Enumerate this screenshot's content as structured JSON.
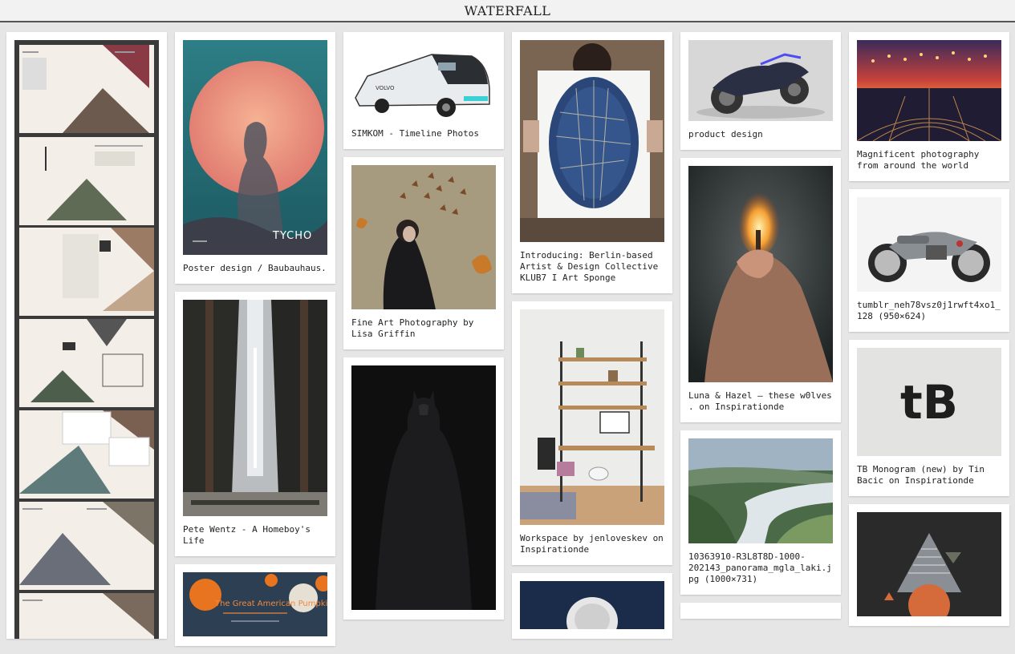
{
  "header": {
    "title": "WATERFALL"
  },
  "columns": [
    [
      {
        "image": "brochure-spread-image",
        "caption": ""
      }
    ],
    [
      {
        "image": "tycho-poster-image",
        "caption": "Poster design / Baubauhaus."
      },
      {
        "image": "forest-waterfall-image",
        "caption": "Pete Wentz - A Homeboy's Life"
      },
      {
        "image": "pumpkin-ad-image",
        "caption": "",
        "text": "The Great American Pumpkin Take-Over"
      }
    ],
    [
      {
        "image": "volvo-truck-image",
        "caption": "SIMKOM - Timeline Photos"
      },
      {
        "image": "butterfly-woman-image",
        "caption": "Fine Art Photography by Lisa Griffin"
      },
      {
        "image": "batman-image",
        "caption": ""
      }
    ],
    [
      {
        "image": "man-holding-artwork-image",
        "caption": "Introducing: Berlin-based Artist & Design Collective KLUB7 I Art Sponge"
      },
      {
        "image": "workspace-image",
        "caption": "Workspace by jenloveskev on Inspirationde"
      },
      {
        "image": "astronaut-image",
        "caption": ""
      }
    ],
    [
      {
        "image": "concept-motorbike-image",
        "caption": "product design"
      },
      {
        "image": "burning-match-image",
        "caption": "Luna & Hazel — these w0lves . on Inspirationde"
      },
      {
        "image": "river-panorama-image",
        "caption": "10363910-R3L8T8D-1000-202143_panorama_mgla_laki.jpg (1000×731)"
      },
      {
        "image": "",
        "caption": ""
      }
    ],
    [
      {
        "image": "city-lights-image",
        "caption": "Magnificent photography from around the world"
      },
      {
        "image": "cafe-racer-image",
        "caption": "tumblr_neh78vsz0j1rwft4xo1_128 (950×624)"
      },
      {
        "image": "tb-monogram-image",
        "caption": "TB Monogram (new) by Tin Bacic on Inspirationde",
        "text": "tB"
      },
      {
        "image": "triangle-art-image",
        "caption": ""
      }
    ]
  ]
}
